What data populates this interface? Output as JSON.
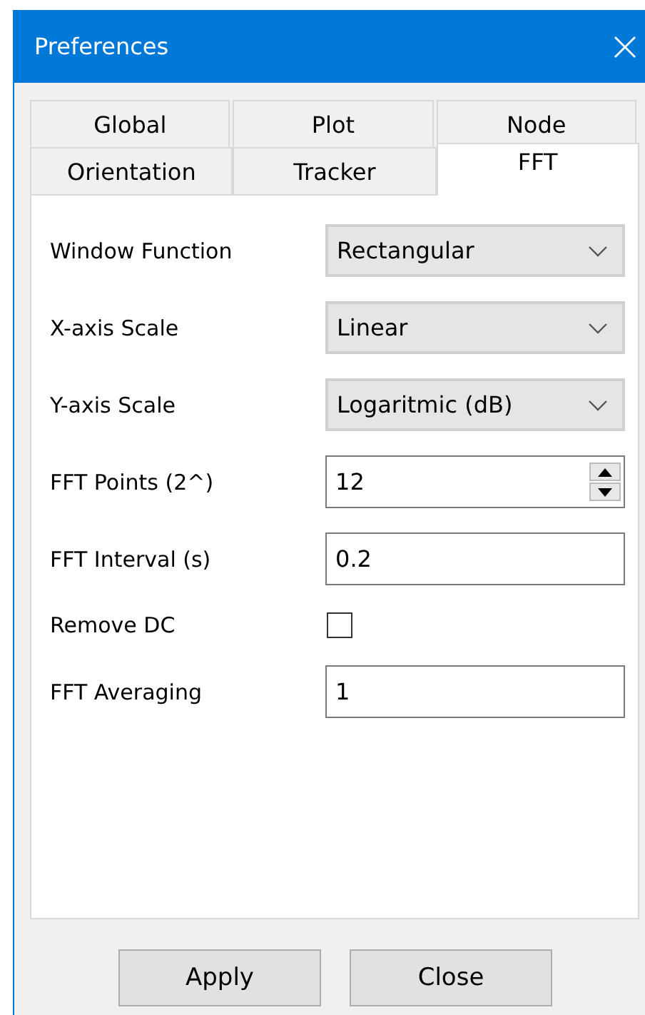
{
  "window": {
    "title": "Preferences"
  },
  "tab_rows": [
    [
      {
        "label": "Global",
        "selected": false
      },
      {
        "label": "Plot",
        "selected": false
      },
      {
        "label": "Node",
        "selected": false
      }
    ],
    [
      {
        "label": "Orientation",
        "selected": false
      },
      {
        "label": "Tracker",
        "selected": false
      },
      {
        "label": "FFT",
        "selected": true
      }
    ]
  ],
  "fields": [
    {
      "kind": "select",
      "label": "Window Function",
      "value": "Rectangular"
    },
    {
      "kind": "select",
      "label": "X-axis Scale",
      "value": "Linear"
    },
    {
      "kind": "select",
      "label": "Y-axis Scale",
      "value": "Logaritmic (dB)"
    },
    {
      "kind": "spin",
      "label": "FFT Points (2^)",
      "value": "12"
    },
    {
      "kind": "text",
      "label": "FFT Interval (s)",
      "value": "0.2"
    },
    {
      "kind": "checkbox",
      "label": "Remove DC",
      "checked": false
    },
    {
      "kind": "text",
      "label": "FFT Averaging",
      "value": "1"
    }
  ],
  "buttons": [
    "Apply",
    "Close"
  ]
}
